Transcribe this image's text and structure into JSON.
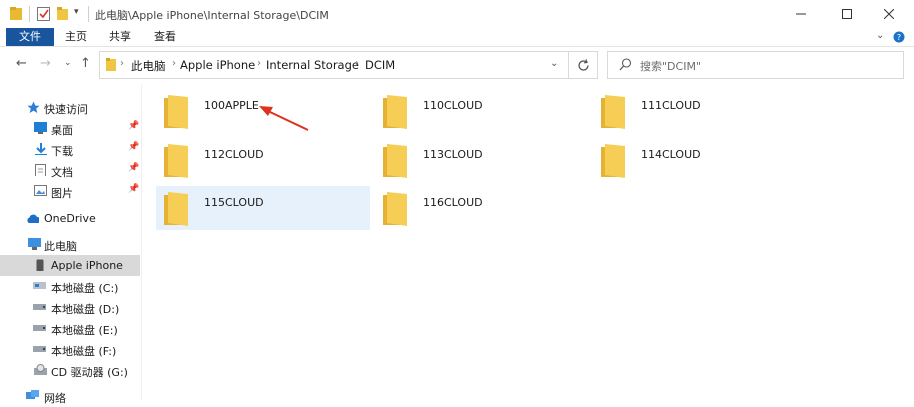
{
  "title": "此电脑\\Apple iPhone\\Internal Storage\\DCIM",
  "ribbon": {
    "tabs": [
      "文件",
      "主页",
      "共享",
      "查看"
    ]
  },
  "address": {
    "crumbs": [
      "此电脑",
      "Apple iPhone",
      "Internal Storage",
      "DCIM"
    ]
  },
  "search": {
    "placeholder": "搜索\"DCIM\""
  },
  "sidebar": {
    "quick_access": "快速访问",
    "pinned": [
      "桌面",
      "下载",
      "文档",
      "图片"
    ],
    "onedrive": "OneDrive",
    "this_pc": "此电脑",
    "drives": [
      "Apple iPhone",
      "本地磁盘 (C:)",
      "本地磁盘 (D:)",
      "本地磁盘 (E:)",
      "本地磁盘 (F:)",
      "CD 驱动器 (G:)"
    ],
    "network": "网络",
    "selected": "Apple iPhone"
  },
  "folders": [
    "100APPLE",
    "110CLOUD",
    "111CLOUD",
    "112CLOUD",
    "113CLOUD",
    "114CLOUD",
    "115CLOUD",
    "116CLOUD"
  ],
  "selected_folder": "115CLOUD",
  "colors": {
    "folder": "#F4C542",
    "file_tab": "#19559C",
    "selection": "#E6F1FB",
    "nav_selection": "#D9D9D9",
    "annotation_arrow": "#E0301E"
  }
}
